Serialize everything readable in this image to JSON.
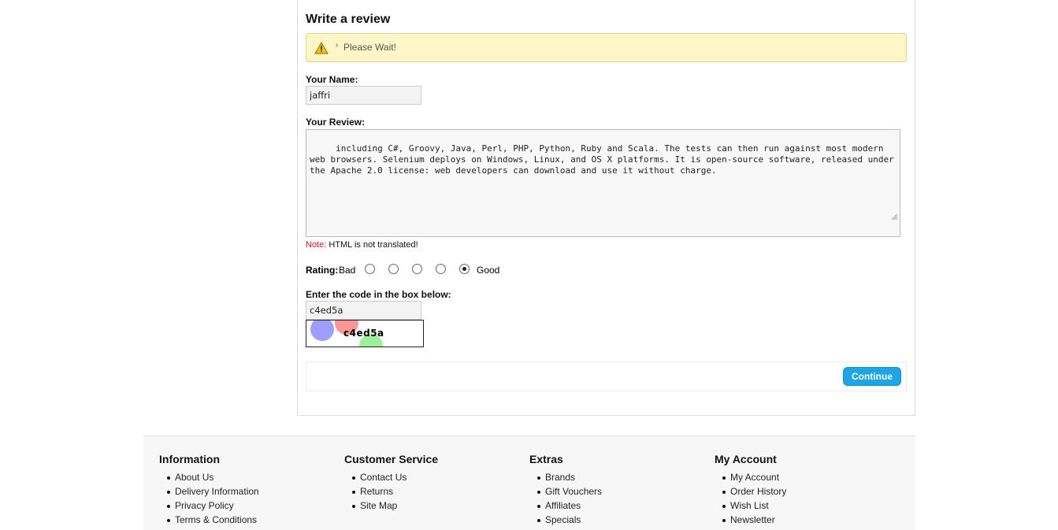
{
  "review_form": {
    "title": "Write a review",
    "attention_text": "Please Wait!",
    "name_label": "Your Name:",
    "name_value": "jaffri",
    "review_label": "Your Review:",
    "review_text": " including C#, Groovy, Java, Perl, PHP, Python, Ruby and Scala. The tests can then run against most modern web browsers. Selenium deploys on Windows, Linux, and OS X platforms. It is open-source software, released under the Apache 2.0 license: web developers can download and use it without charge.",
    "note_label": "Note:",
    "note_text": " HTML is not translated!",
    "rating_label": "Rating:",
    "rating_bad": "Bad",
    "rating_good": "Good",
    "rating_selected": 5,
    "captcha_label": "Enter the code in the box below:",
    "captcha_value": "c4ed5a",
    "captcha_image_text": "c4ed5a",
    "continue_label": "Continue"
  },
  "footer": {
    "columns": [
      {
        "title": "Information",
        "items": [
          "About Us",
          "Delivery Information",
          "Privacy Policy",
          "Terms & Conditions"
        ]
      },
      {
        "title": "Customer Service",
        "items": [
          "Contact Us",
          "Returns",
          "Site Map"
        ]
      },
      {
        "title": "Extras",
        "items": [
          "Brands",
          "Gift Vouchers",
          "Affiliates",
          "Specials"
        ]
      },
      {
        "title": "My Account",
        "items": [
          "My Account",
          "Order History",
          "Wish List",
          "Newsletter"
        ]
      }
    ]
  },
  "colors": {
    "attention_bg": "#fff6c8",
    "continue_button": "#1ea5e5",
    "note_label": "#dd1111"
  }
}
